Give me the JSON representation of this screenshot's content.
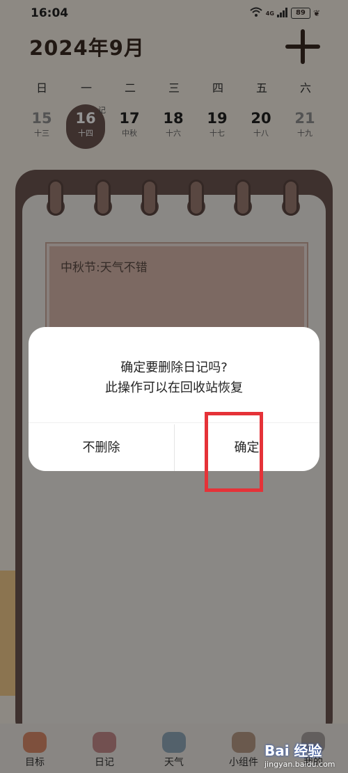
{
  "status_bar": {
    "time": "16:04",
    "network": "4G",
    "battery": "89"
  },
  "header": {
    "month_title": "2024年9月"
  },
  "week": {
    "weekdays": [
      "日",
      "一",
      "二",
      "三",
      "四",
      "五",
      "六"
    ],
    "dates": [
      {
        "day": "15",
        "lunar": "十三"
      },
      {
        "day": "16",
        "lunar": "十四"
      },
      {
        "day": "17",
        "lunar": "中秋"
      },
      {
        "day": "18",
        "lunar": "十六"
      },
      {
        "day": "19",
        "lunar": "十七"
      },
      {
        "day": "20",
        "lunar": "十八"
      },
      {
        "day": "21",
        "lunar": "十九"
      }
    ],
    "diary_badge": "记"
  },
  "note": {
    "text": "中秋节:天气不错"
  },
  "tabs": [
    {
      "label": "目标",
      "icon": "target-icon"
    },
    {
      "label": "日记",
      "icon": "diary-icon"
    },
    {
      "label": "天气",
      "icon": "weather-icon"
    },
    {
      "label": "小组件",
      "icon": "widget-icon"
    },
    {
      "label": "我的",
      "icon": "profile-icon"
    }
  ],
  "dialog": {
    "line1": "确定要删除日记吗?",
    "line2": "此操作可以在回收站恢复",
    "cancel_label": "不删除",
    "confirm_label": "确定"
  },
  "watermark": {
    "main": "Bai 经验",
    "sub": "jingyan.baidu.com"
  },
  "colors": {
    "accent": "#6b5550",
    "highlight": "#e53238"
  }
}
